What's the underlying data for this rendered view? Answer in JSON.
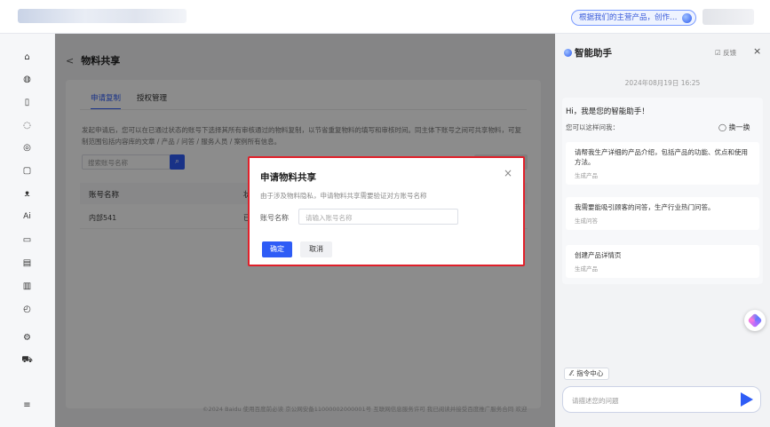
{
  "topbar": {
    "pill_text": "根据我们的主营产品，创作…"
  },
  "sidebar": {
    "icons": [
      "home-icon",
      "bag-icon",
      "doc-icon",
      "chat-icon",
      "target-icon",
      "file-icon",
      "people-icon",
      "ai-icon",
      "box-icon",
      "doc2-icon",
      "doc3-icon",
      "clock-icon",
      "settings-icon",
      "cart-icon",
      "menu-icon"
    ]
  },
  "main": {
    "back": "<",
    "title": "物料共享",
    "tabs": [
      "申请复制",
      "授权管理"
    ],
    "description": "发起申请后，您可以在已通过状态的账号下选择其所有审核通过的物料复制，以节省重复物料的填写和审核时间。同主体下账号之间可共享物料，可复制范围包括内容库的文章 / 产品 / 问答 / 服务人员 / 案例所有信息。",
    "search_placeholder": "搜索账号名称",
    "table": {
      "headers": [
        "账号名称",
        "状态"
      ],
      "rows": [
        [
          "内部541",
          "已通"
        ]
      ]
    },
    "footer": "©2024 Baidu 使用百度前必读 京公网安备11000002000001号 互联网信息服务许可 我已阅读并接受百度推广服务合同 欢迎"
  },
  "modal": {
    "title": "申请物料共享",
    "close": "×",
    "subtitle": "由于涉及物料隐私，申请物料共享需要验证对方账号名称",
    "field_label": "账号名称",
    "field_placeholder": "请输入账号名称",
    "ok": "确定",
    "cancel": "取消"
  },
  "assistant": {
    "title": "智能助手",
    "feedback": "☑ 反馈",
    "close": "×",
    "date": "2024年08月19日 16:25",
    "hello": "Hi，我是您的智能助手！",
    "ask": "您可以这样问我：",
    "refresh": "◯ 换一换",
    "suggestions": [
      {
        "q": "请帮我生产详细的产品介绍，包括产品的功能、优点和使用方法。",
        "tag": "生成产品"
      },
      {
        "q": "我需要能吸引顾客的问答，生产行业热门问答。",
        "tag": "生成问答"
      },
      {
        "q": "创建产品详情页",
        "tag": "生成产品"
      }
    ],
    "cmd": "⁄⁄. 指令中心",
    "input_placeholder": "请描述您的问题"
  }
}
